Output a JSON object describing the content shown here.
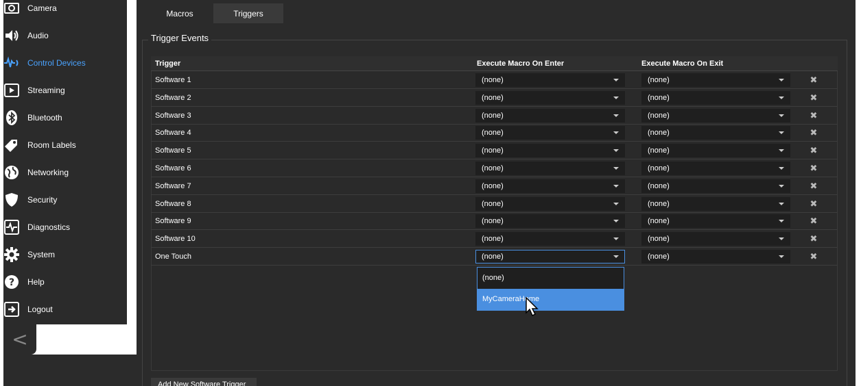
{
  "sidebar": {
    "items": [
      {
        "label": "Camera",
        "icon": "camera-icon"
      },
      {
        "label": "Audio",
        "icon": "speaker-icon"
      },
      {
        "label": "Control Devices",
        "icon": "control-devices-icon",
        "active": true
      },
      {
        "label": "Streaming",
        "icon": "play-icon"
      },
      {
        "label": "Bluetooth",
        "icon": "bluetooth-icon"
      },
      {
        "label": "Room Labels",
        "icon": "tag-icon"
      },
      {
        "label": "Networking",
        "icon": "globe-icon"
      },
      {
        "label": "Security",
        "icon": "shield-icon"
      },
      {
        "label": "Diagnostics",
        "icon": "pulse-icon"
      },
      {
        "label": "System",
        "icon": "gear-icon"
      },
      {
        "label": "Help",
        "icon": "help-icon"
      },
      {
        "label": "Logout",
        "icon": "logout-icon"
      }
    ],
    "collapse_glyph": "<",
    "accent_color": "#4aa3ff"
  },
  "tabs": [
    {
      "label": "Macros"
    },
    {
      "label": "Triggers",
      "selected": true
    }
  ],
  "section": {
    "legend": "Trigger Events"
  },
  "table": {
    "columns": [
      "Trigger",
      "Execute Macro On Enter",
      "Execute Macro On Exit"
    ],
    "rows": [
      {
        "name": "Software 1",
        "enter": "(none)",
        "exit": "(none)"
      },
      {
        "name": "Software 2",
        "enter": "(none)",
        "exit": "(none)"
      },
      {
        "name": "Software 3",
        "enter": "(none)",
        "exit": "(none)"
      },
      {
        "name": "Software 4",
        "enter": "(none)",
        "exit": "(none)"
      },
      {
        "name": "Software 5",
        "enter": "(none)",
        "exit": "(none)"
      },
      {
        "name": "Software 6",
        "enter": "(none)",
        "exit": "(none)"
      },
      {
        "name": "Software 7",
        "enter": "(none)",
        "exit": "(none)"
      },
      {
        "name": "Software 8",
        "enter": "(none)",
        "exit": "(none)"
      },
      {
        "name": "Software 9",
        "enter": "(none)",
        "exit": "(none)"
      },
      {
        "name": "Software 10",
        "enter": "(none)",
        "exit": "(none)"
      },
      {
        "name": "One Touch",
        "enter": "(none)",
        "exit": "(none)"
      }
    ],
    "delete_glyph": "✖"
  },
  "dropdown": {
    "options": [
      "(none)",
      "MyCameraHome"
    ],
    "highlighted": "MyCameraHome",
    "highlight_color": "#4a8fe0"
  },
  "add_button": {
    "label": "Add New Software Trigger"
  }
}
